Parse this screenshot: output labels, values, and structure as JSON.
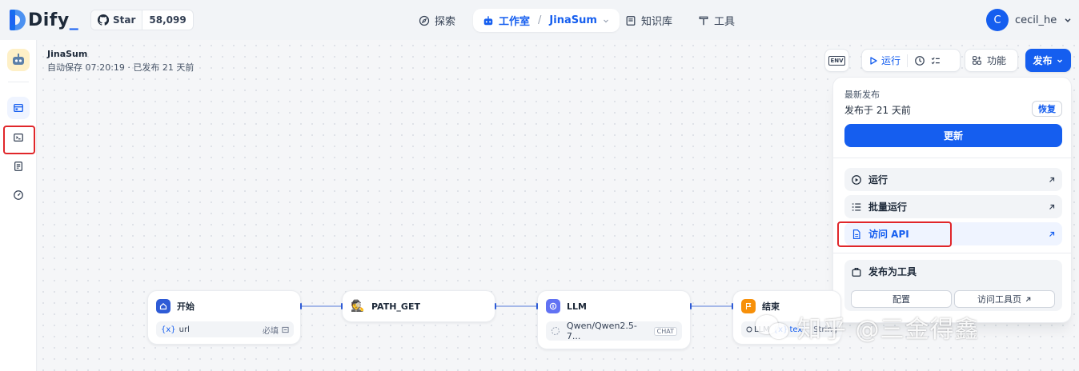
{
  "brand": {
    "name": "Dify",
    "accent": "#155eef"
  },
  "github": {
    "star_label": "Star",
    "star_count": "58,099"
  },
  "nav": {
    "explore": "探索",
    "studio": "工作室",
    "studio_app": "JinaSum",
    "knowledge": "知识库",
    "tools": "工具"
  },
  "user": {
    "initial": "C",
    "name": "cecil_he"
  },
  "app": {
    "name": "JinaSum",
    "meta": "自动保存 07:20:19 · 已发布 21 天前"
  },
  "toolbar": {
    "env": "ENV",
    "run": "运行",
    "features": "功能",
    "publish": "发布"
  },
  "publish_panel": {
    "title": "最新发布",
    "subtitle": "发布于 21 天前",
    "restore": "恢复",
    "update": "更新",
    "items": [
      {
        "label": "运行",
        "icon": "play-circle-icon"
      },
      {
        "label": "批量运行",
        "icon": "batch-list-icon"
      },
      {
        "label": "访问 API",
        "icon": "document-icon"
      }
    ],
    "tool_section": {
      "title": "发布为工具",
      "configure": "配置",
      "visit_tool_page": "访问工具页"
    }
  },
  "nodes": {
    "start": {
      "title": "开始",
      "var": "url",
      "required": "必填"
    },
    "path_get": {
      "title": "PATH_GET"
    },
    "llm": {
      "title": "LLM",
      "model": "Qwen/Qwen2.5-7...",
      "mode": "CHAT"
    },
    "end": {
      "title": "结束",
      "src": "LLM",
      "var": "text",
      "type": "String"
    }
  },
  "watermark": {
    "text": "知乎 @三金得鑫"
  }
}
